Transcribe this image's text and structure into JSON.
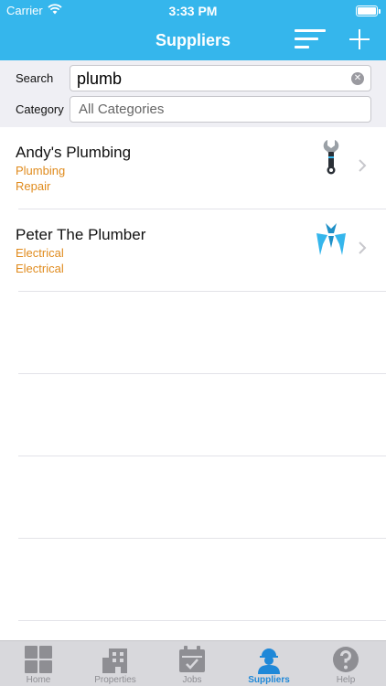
{
  "status_bar": {
    "carrier": "Carrier",
    "time": "3:33 PM"
  },
  "nav": {
    "title": "Suppliers",
    "sort_icon": "sort-lines-icon",
    "add_icon": "plus-icon"
  },
  "filters": {
    "search_label": "Search",
    "search_value": "plumb",
    "category_label": "Category",
    "category_value": "All Categories"
  },
  "suppliers": [
    {
      "name": "Andy's Plumbing",
      "categories": [
        "Plumbing",
        "Repair"
      ],
      "logo_icon": "wrench-logo-icon"
    },
    {
      "name": "Peter The Plumber",
      "categories": [
        "Electrical",
        "Electrical"
      ],
      "logo_icon": "geometric-logo-icon"
    }
  ],
  "tabs": [
    {
      "label": "Home",
      "icon": "home-grid-icon",
      "active": false
    },
    {
      "label": "Properties",
      "icon": "building-icon",
      "active": false
    },
    {
      "label": "Jobs",
      "icon": "calendar-icon",
      "active": false
    },
    {
      "label": "Suppliers",
      "icon": "worker-icon",
      "active": true
    },
    {
      "label": "Help",
      "icon": "help-icon",
      "active": false
    }
  ],
  "colors": {
    "accent": "#35b6ec",
    "category_text": "#e08b1d",
    "tab_active": "#1f88d8",
    "tab_inactive": "#8e8e93"
  }
}
